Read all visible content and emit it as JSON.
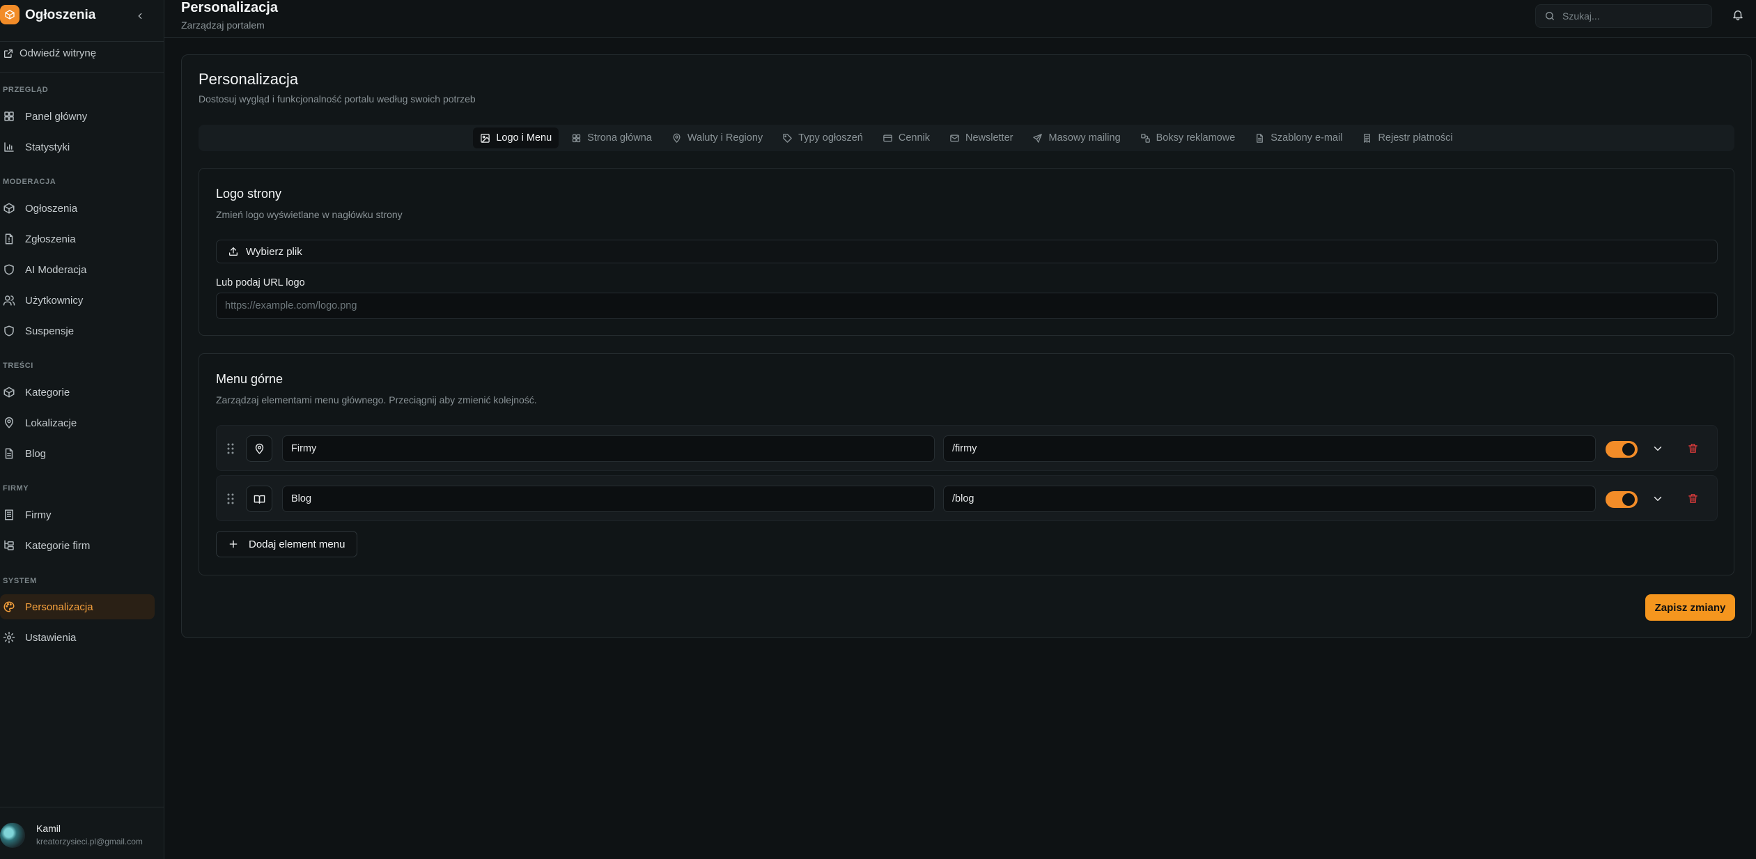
{
  "app": {
    "name": "Ogłoszenia",
    "visit_site": "Odwiedź witrynę"
  },
  "sidebar": {
    "sections": [
      {
        "label": "PRZEGLĄD",
        "items": [
          {
            "label": "Panel główny",
            "icon": "layout-grid-icon"
          },
          {
            "label": "Statystyki",
            "icon": "bar-chart-icon"
          }
        ]
      },
      {
        "label": "MODERACJA",
        "items": [
          {
            "label": "Ogłoszenia",
            "icon": "package-icon"
          },
          {
            "label": "Zgłoszenia",
            "icon": "file-alert-icon"
          },
          {
            "label": "AI Moderacja",
            "icon": "shield-icon"
          },
          {
            "label": "Użytkownicy",
            "icon": "users-icon"
          },
          {
            "label": "Suspensje",
            "icon": "shield-icon"
          }
        ]
      },
      {
        "label": "TREŚCI",
        "items": [
          {
            "label": "Kategorie",
            "icon": "package-icon"
          },
          {
            "label": "Lokalizacje",
            "icon": "map-pin-icon"
          },
          {
            "label": "Blog",
            "icon": "file-text-icon"
          }
        ]
      },
      {
        "label": "FIRMY",
        "items": [
          {
            "label": "Firmy",
            "icon": "building-icon"
          },
          {
            "label": "Kategorie firm",
            "icon": "folder-tree-icon"
          }
        ]
      },
      {
        "label": "SYSTEM",
        "items": [
          {
            "label": "Personalizacja",
            "icon": "palette-icon",
            "active": true
          },
          {
            "label": "Ustawienia",
            "icon": "gear-icon"
          }
        ]
      }
    ]
  },
  "user": {
    "name": "Kamil",
    "email": "kreatorzysieci.pl@gmail.com"
  },
  "header": {
    "title": "Personalizacja",
    "subtitle": "Zarządzaj portalem",
    "search_placeholder": "Szukaj..."
  },
  "main": {
    "title": "Personalizacja",
    "description": "Dostosuj wygląd i funkcjonalność portalu według swoich potrzeb",
    "tabs": [
      {
        "label": "Logo i Menu",
        "icon": "image-icon",
        "active": true
      },
      {
        "label": "Strona główna",
        "icon": "layout-grid-icon"
      },
      {
        "label": "Waluty i Regiony",
        "icon": "map-pin-icon"
      },
      {
        "label": "Typy ogłoszeń",
        "icon": "tag-icon"
      },
      {
        "label": "Cennik",
        "icon": "credit-card-icon"
      },
      {
        "label": "Newsletter",
        "icon": "mail-icon"
      },
      {
        "label": "Masowy mailing",
        "icon": "send-icon"
      },
      {
        "label": "Boksy reklamowe",
        "icon": "blocks-icon"
      },
      {
        "label": "Szablony e-mail",
        "icon": "file-text-icon"
      },
      {
        "label": "Rejestr płatności",
        "icon": "receipt-icon"
      }
    ],
    "logo": {
      "title": "Logo strony",
      "description": "Zmień logo wyświetlane w nagłówku strony",
      "file_button": "Wybierz plik",
      "url_label": "Lub podaj URL logo",
      "url_placeholder": "https://example.com/logo.png"
    },
    "menu": {
      "title": "Menu górne",
      "description": "Zarządzaj elementami menu głównego. Przeciągnij aby zmienić kolejność.",
      "items": [
        {
          "label": "Firmy",
          "url": "/firmy",
          "icon": "map-pin-icon",
          "enabled": true
        },
        {
          "label": "Blog",
          "url": "/blog",
          "icon": "book-open-icon",
          "enabled": true
        }
      ],
      "add_button": "Dodaj element menu"
    },
    "save_button": "Zapisz zmiany"
  },
  "colors": {
    "accent": "#f28c28",
    "background": "#0e1214",
    "danger": "#d43a3a"
  }
}
